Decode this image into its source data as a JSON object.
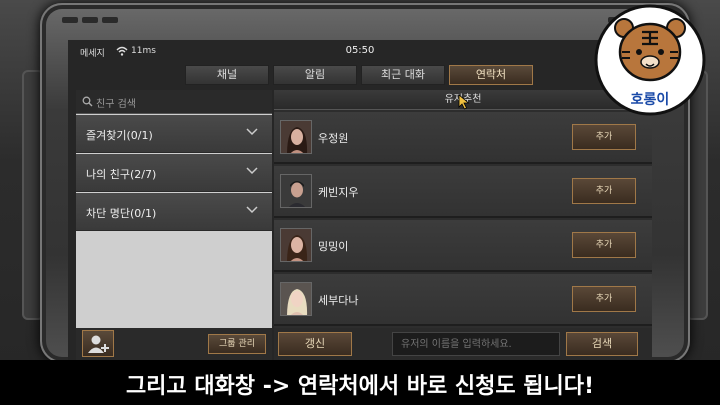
{
  "status": {
    "carrier": "메세지",
    "latency": "11ms",
    "time": "05:50"
  },
  "tabs": [
    {
      "label": "채널"
    },
    {
      "label": "알림"
    },
    {
      "label": "최근 대화"
    },
    {
      "label": "연락처",
      "active": true
    }
  ],
  "left": {
    "search_placeholder": "친구 검색",
    "categories": [
      {
        "label": "즐겨찾기(0/1)"
      },
      {
        "label": "나의 친구(2/7)"
      },
      {
        "label": "차단 명단(0/1)"
      }
    ],
    "group_manage_label": "그룹 관리"
  },
  "right": {
    "header": "유저추천",
    "users": [
      {
        "name": "우정원",
        "add_label": "추가"
      },
      {
        "name": "케빈지우",
        "add_label": "추가"
      },
      {
        "name": "밍밍이",
        "add_label": "추가"
      },
      {
        "name": "세부다나",
        "add_label": "추가"
      }
    ],
    "refresh_label": "갱신",
    "input_placeholder": "유저의 이름을 입력하세요.",
    "search_label": "검색"
  },
  "caption": "그리고 대화창 -> 연락처에서 바로 신청도 됩니다!",
  "logo_text": "호롱이",
  "icons": [
    "wifi-icon",
    "search-icon",
    "chevron-down-icon",
    "add-friend-icon",
    "cursor-icon",
    "tiger-logo"
  ],
  "colors": {
    "accent_border": "#a07848",
    "caption_bg": "#000000"
  }
}
